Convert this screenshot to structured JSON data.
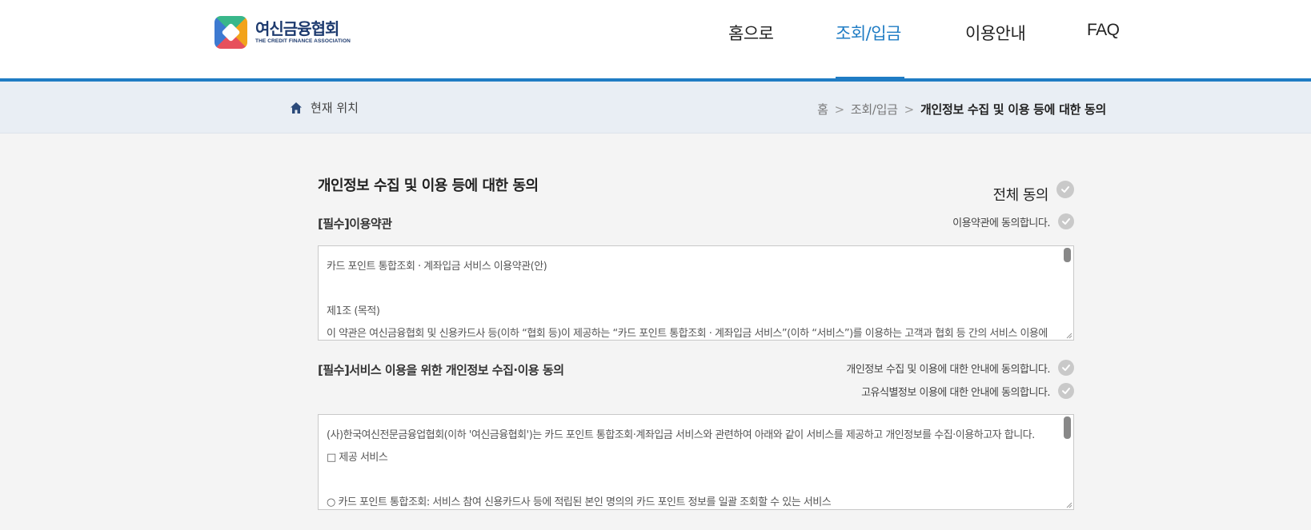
{
  "logo": {
    "ko": "여신금융협회",
    "en": "THE CREDIT FINANCE ASSOCIATION"
  },
  "nav": {
    "items": [
      {
        "label": "홈으로"
      },
      {
        "label": "조회/입금"
      },
      {
        "label": "이용안내"
      },
      {
        "label": "FAQ"
      }
    ],
    "active_index": 1,
    "accent": "#1f7cc4"
  },
  "location": {
    "label": "현재 위치",
    "crumbs": [
      "홈",
      "조회/입금",
      "개인정보 수집 및 이용 등에 대한 동의"
    ],
    "separator": ">"
  },
  "page": {
    "title": "개인정보 수집 및 이용 등에 대한 동의",
    "all_agree": "전체 동의"
  },
  "terms": {
    "title": "[필수]이용약관",
    "agree_text": "이용약관에 동의합니다.",
    "lines": [
      "카드 포인트 통합조회 · 계좌입금 서비스 이용약관(안)",
      "",
      "제1조 (목적)",
      "이 약관은 여신금융협회 및 신용카드사 등(이하 “협회 등)이 제공하는 “카드 포인트 통합조회 · 계좌입금 서비스”(이하 “서비스”)를 이용하는 고객과 협회 등 간의 서비스 이용에"
    ]
  },
  "privacy": {
    "title": "[필수]서비스 이용을 위한 개인정보 수집·이용 동의",
    "agree_texts": [
      "개인정보 수집 및 이용에 대한 안내에 동의합니다.",
      "고유식별정보 이용에 대한 안내에 동의합니다."
    ],
    "lines": [
      "(사)한국여신전문금융업협회(이하 '여신금융협회')는 카드 포인트 통합조회·계좌입금 서비스와 관련하여 아래와 같이 서비스를 제공하고 개인정보를 수집·이용하고자 합니다.",
      "□ 제공 서비스",
      "",
      " ○ 카드 포인트 통합조회: 서비스 참여 신용카드사 등에 적립된 본인 명의의 카드 포인트 정보를 일괄 조회할 수 있는 서비스"
    ]
  }
}
